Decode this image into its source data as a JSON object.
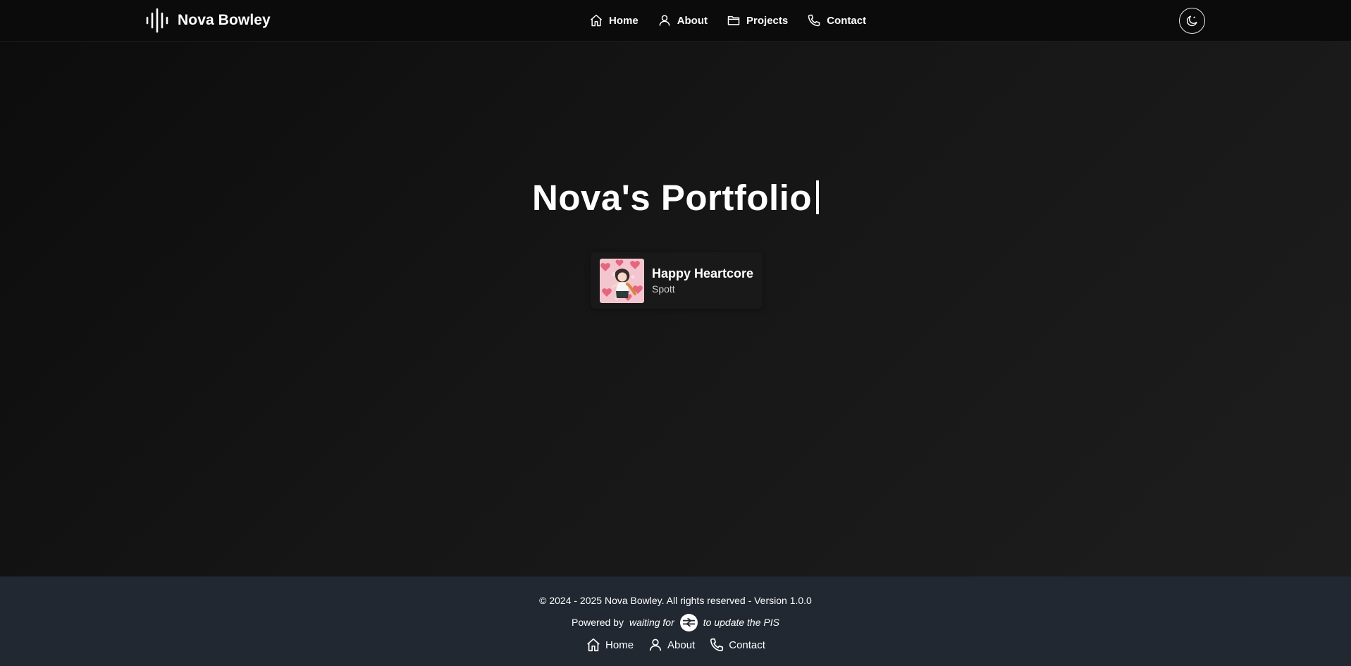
{
  "header": {
    "brand": {
      "name": "Nova Bowley",
      "icon": "soundwave-icon"
    },
    "nav": [
      {
        "label": "Home",
        "icon": "home-icon"
      },
      {
        "label": "About",
        "icon": "user-icon"
      },
      {
        "label": "Projects",
        "icon": "folder-icon"
      },
      {
        "label": "Contact",
        "icon": "phone-icon"
      }
    ],
    "theme_toggle": {
      "icon": "moon-icon"
    }
  },
  "hero": {
    "title": "Nova's Portfolio"
  },
  "now_playing": {
    "title": "Happy Heartcore",
    "artist": "Spott",
    "cover_icon": "album-cover-image"
  },
  "footer": {
    "copyright": "© 2024 - 2025 Nova Bowley. All rights reserved - Version 1.0.0",
    "powered_by_lead": "Powered by",
    "powered_by_text_1": "waiting for",
    "powered_by_badge_icon": "national-rail-icon",
    "powered_by_text_2": "to update the PIS",
    "links": [
      {
        "label": "Home",
        "icon": "home-icon"
      },
      {
        "label": "About",
        "icon": "user-icon"
      },
      {
        "label": "Contact",
        "icon": "phone-icon"
      }
    ]
  },
  "colors": {
    "header_bg": "#0b0b0b",
    "page_bg_start": "#0c0c0c",
    "page_bg_end": "#1e1e1e",
    "card_bg": "#191919",
    "footer_bg": "#222831",
    "text": "#ffffff"
  }
}
